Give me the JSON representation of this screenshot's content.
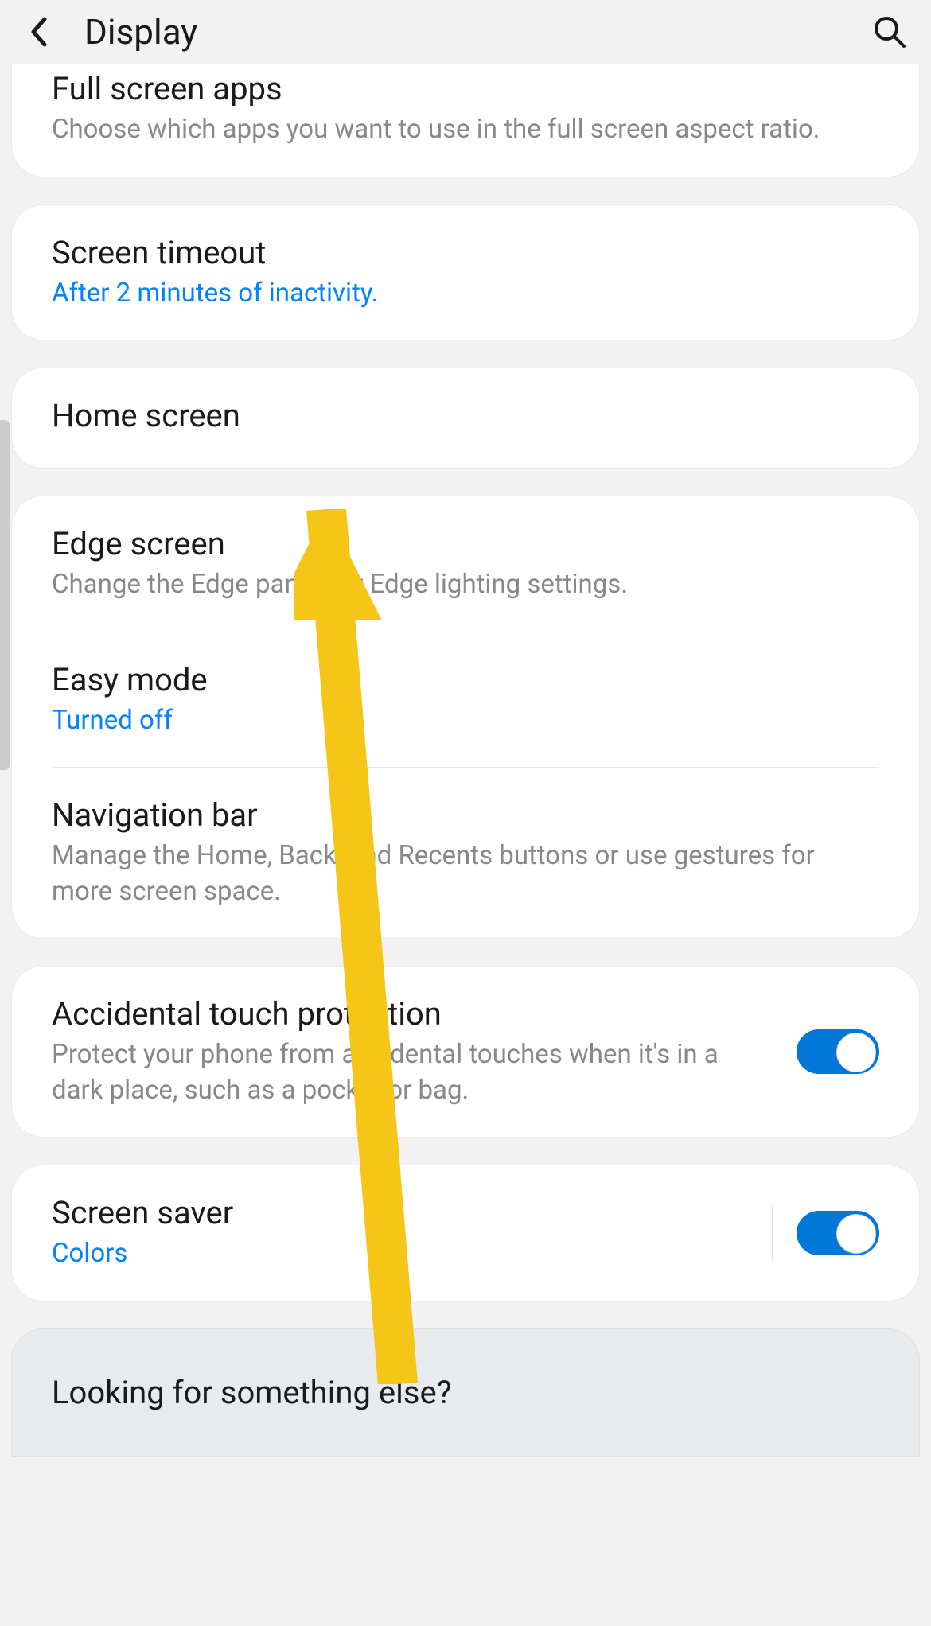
{
  "header": {
    "title": "Display"
  },
  "groups": [
    {
      "items": [
        {
          "title": "Full screen apps",
          "subtitle": "Choose which apps you want to use in the full screen aspect ratio.",
          "subtitle_accent": false
        }
      ]
    },
    {
      "items": [
        {
          "title": "Screen timeout",
          "subtitle": "After 2 minutes of inactivity.",
          "subtitle_accent": true
        }
      ]
    },
    {
      "items": [
        {
          "title": "Home screen",
          "subtitle": null
        }
      ]
    },
    {
      "items": [
        {
          "title": "Edge screen",
          "subtitle": "Change the Edge panels or Edge lighting settings.",
          "subtitle_accent": false
        },
        {
          "title": "Easy mode",
          "subtitle": "Turned off",
          "subtitle_accent": true
        },
        {
          "title": "Navigation bar",
          "subtitle": "Manage the Home, Back, and Recents buttons or use gestures for more screen space.",
          "subtitle_accent": false
        }
      ]
    },
    {
      "items": [
        {
          "title": "Accidental touch protection",
          "subtitle": "Protect your phone from accidental touches when it's in a dark place, such as a pocket or bag.",
          "subtitle_accent": false,
          "toggle": true
        }
      ]
    },
    {
      "items": [
        {
          "title": "Screen saver",
          "subtitle": "Colors",
          "subtitle_accent": true,
          "toggle": true,
          "toggle_divider": true
        }
      ]
    }
  ],
  "footer": {
    "title": "Looking for something else?"
  }
}
